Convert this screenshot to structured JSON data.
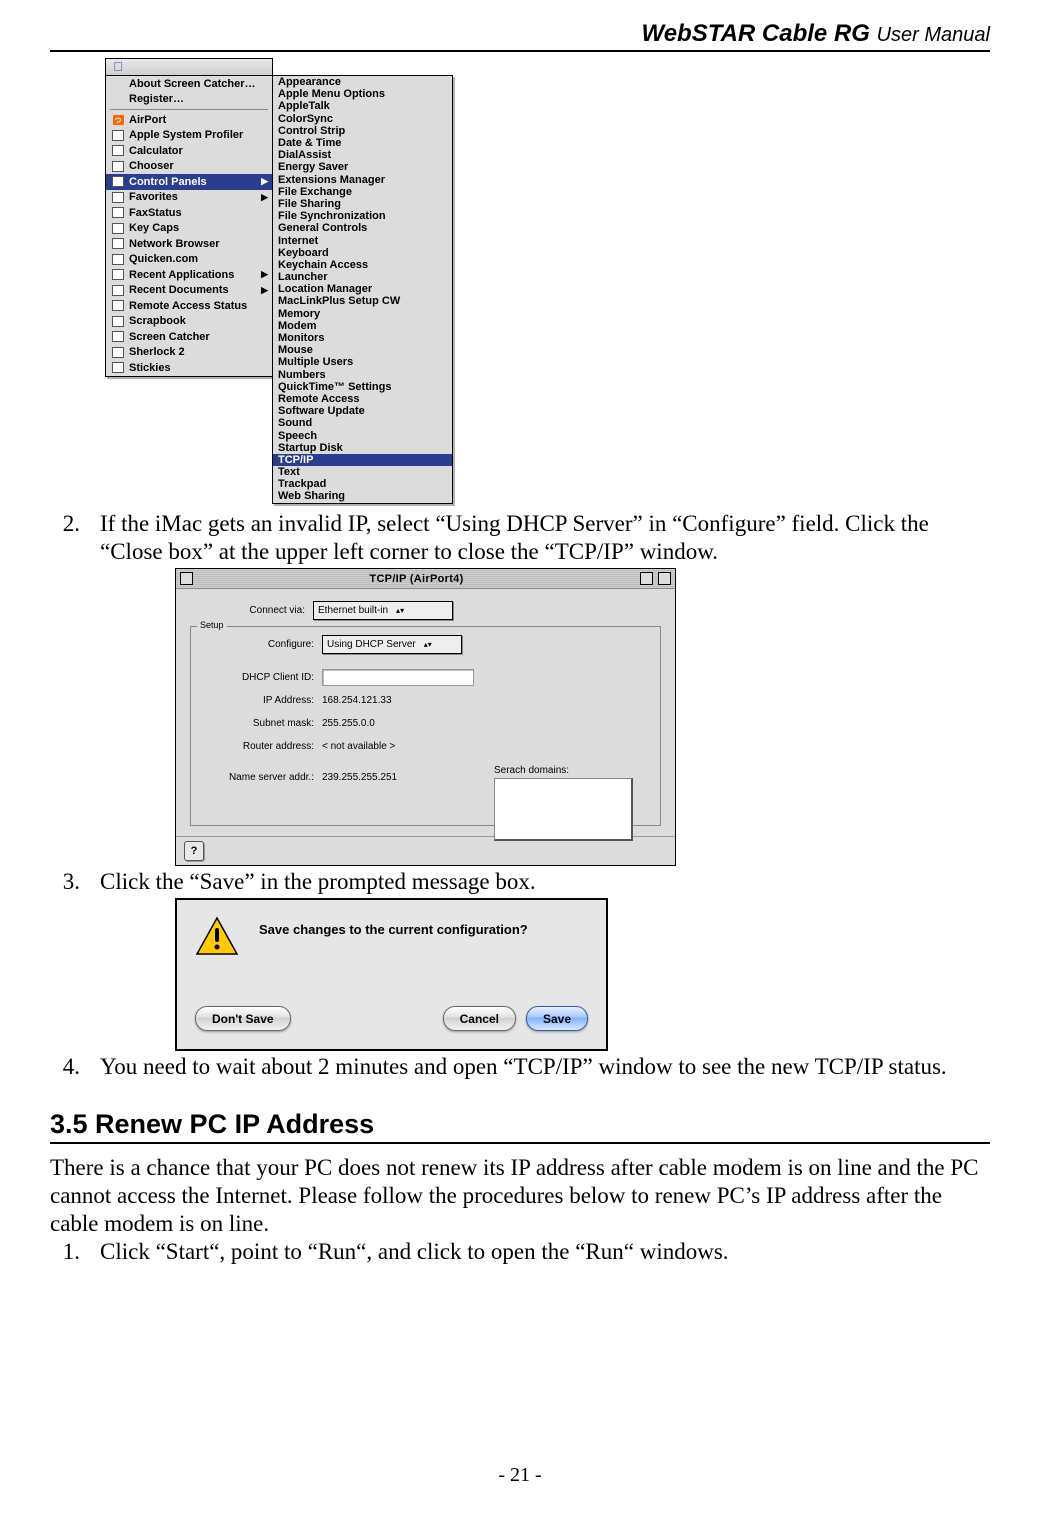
{
  "header": {
    "product": "WebSTAR Cable RG",
    "subtitle": "User Manual"
  },
  "apple_menu": {
    "top": [
      {
        "label": "About Screen Catcher…",
        "icon": ""
      },
      {
        "label": "Register…",
        "icon": ""
      }
    ],
    "main": [
      {
        "label": "AirPort",
        "icon": "rss",
        "arrow": false
      },
      {
        "label": "Apple System Profiler",
        "icon": "box",
        "arrow": false
      },
      {
        "label": "Calculator",
        "icon": "box",
        "arrow": false
      },
      {
        "label": "Chooser",
        "icon": "box",
        "arrow": false
      },
      {
        "label": "Control Panels",
        "icon": "box",
        "arrow": true,
        "selected": true
      },
      {
        "label": "Favorites",
        "icon": "box",
        "arrow": true
      },
      {
        "label": "FaxStatus",
        "icon": "box",
        "arrow": false
      },
      {
        "label": "Key Caps",
        "icon": "box",
        "arrow": false
      },
      {
        "label": "Network Browser",
        "icon": "box",
        "arrow": false
      },
      {
        "label": "Quicken.com",
        "icon": "box",
        "arrow": false
      },
      {
        "label": "Recent Applications",
        "icon": "box",
        "arrow": true
      },
      {
        "label": "Recent Documents",
        "icon": "box",
        "arrow": true
      },
      {
        "label": "Remote Access Status",
        "icon": "box",
        "arrow": false
      },
      {
        "label": "Scrapbook",
        "icon": "box",
        "arrow": false
      },
      {
        "label": "Screen Catcher",
        "icon": "box",
        "arrow": false
      },
      {
        "label": "Sherlock 2",
        "icon": "box",
        "arrow": false
      },
      {
        "label": "Stickies",
        "icon": "box",
        "arrow": false
      }
    ],
    "submenu": [
      "Appearance",
      "Apple Menu Options",
      "AppleTalk",
      "ColorSync",
      "Control Strip",
      "Date & Time",
      "DialAssist",
      "Energy Saver",
      "Extensions Manager",
      "File Exchange",
      "File Sharing",
      "File Synchronization",
      "General Controls",
      "Internet",
      "Keyboard",
      "Keychain Access",
      "Launcher",
      "Location Manager",
      "MacLinkPlus Setup CW",
      "Memory",
      "Modem",
      "Monitors",
      "Mouse",
      "Multiple Users",
      "Numbers",
      "QuickTime™ Settings",
      "Remote Access",
      "Software Update",
      "Sound",
      "Speech",
      "Startup Disk",
      "TCP/IP",
      "Text",
      "Trackpad",
      "Web Sharing"
    ],
    "submenu_selected": "TCP/IP"
  },
  "steps": {
    "s2": {
      "num": "2.",
      "text": "If the iMac gets an invalid IP, select “Using DHCP Server” in “Configure” field. Click the “Close box” at the upper left corner to close the “TCP/IP” window."
    },
    "s3": {
      "num": "3.",
      "text": "Click the “Save” in the prompted message box."
    },
    "s4": {
      "num": "4.",
      "text": "You need to wait about 2 minutes and open “TCP/IP” window to see the new TCP/IP status."
    }
  },
  "tcpip": {
    "title": "TCP/IP (AirPort4)",
    "labels": {
      "connect": "Connect via:",
      "setup": "Setup",
      "configure": "Configure:",
      "dhcp_id": "DHCP Client ID:",
      "ip": "IP Address:",
      "subnet": "Subnet mask:",
      "router": "Router address:",
      "ns": "Name server addr.:",
      "search": "Serach domains:"
    },
    "values": {
      "connect": "Ethernet built-in",
      "configure": "Using DHCP Server",
      "dhcp_id": "",
      "ip": "168.254.121.33",
      "subnet": "255.255.0.0",
      "router": "< not available >",
      "ns": "239.255.255.251"
    }
  },
  "save_dialog": {
    "message": "Save changes to the current configuration?",
    "dont_save": "Don't Save",
    "cancel": "Cancel",
    "save": "Save"
  },
  "section": {
    "title": "3.5 Renew PC IP Address",
    "intro": "There is a chance that your PC does not renew its IP address after cable modem is on line and the PC cannot access the Internet. Please follow the procedures below to renew PC’s IP address after the cable modem is on line.",
    "step1_num": "1.",
    "step1_text": "Click “Start“, point to “Run“, and click to open the “Run“ windows."
  },
  "footer": "- 21 -"
}
